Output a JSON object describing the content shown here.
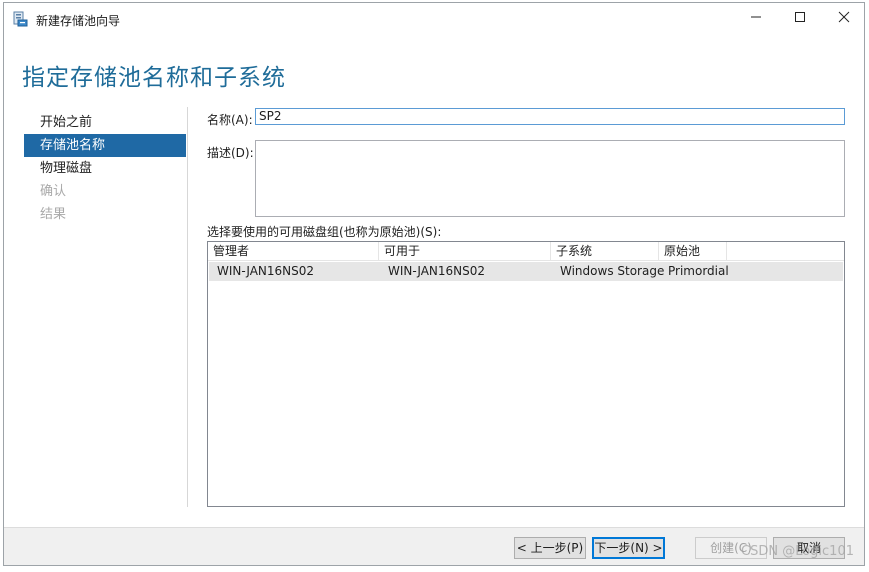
{
  "window": {
    "title": "新建存储池向导",
    "controls": {
      "minimize": "—",
      "maximize": "☐",
      "close": "✕"
    }
  },
  "header": {
    "title": "指定存储池名称和子系统"
  },
  "nav": {
    "items": [
      {
        "label": "开始之前",
        "state": "normal"
      },
      {
        "label": "存储池名称",
        "state": "selected"
      },
      {
        "label": "物理磁盘",
        "state": "normal"
      },
      {
        "label": "确认",
        "state": "disabled"
      },
      {
        "label": "结果",
        "state": "disabled"
      }
    ]
  },
  "form": {
    "name_label": "名称(A):",
    "name_value": "SP2",
    "desc_label": "描述(D):",
    "desc_value": "",
    "pool_label": "选择要使用的可用磁盘组(也称为原始池)(S):"
  },
  "table": {
    "columns": [
      "管理者",
      "可用于",
      "子系统",
      "原始池"
    ],
    "rows": [
      [
        "WIN-JAN16NS02",
        "WIN-JAN16NS02",
        "Windows Storage",
        "Primordial"
      ]
    ]
  },
  "footer": {
    "prev": "< 上一步(P)",
    "next": "下一步(N) >",
    "create": "创建(C)",
    "cancel": "取消"
  },
  "watermark": "CSDN @Logic101",
  "colors": {
    "accent": "#1f69a5",
    "header_title": "#1f6c99",
    "focus_border": "#0078d7"
  }
}
